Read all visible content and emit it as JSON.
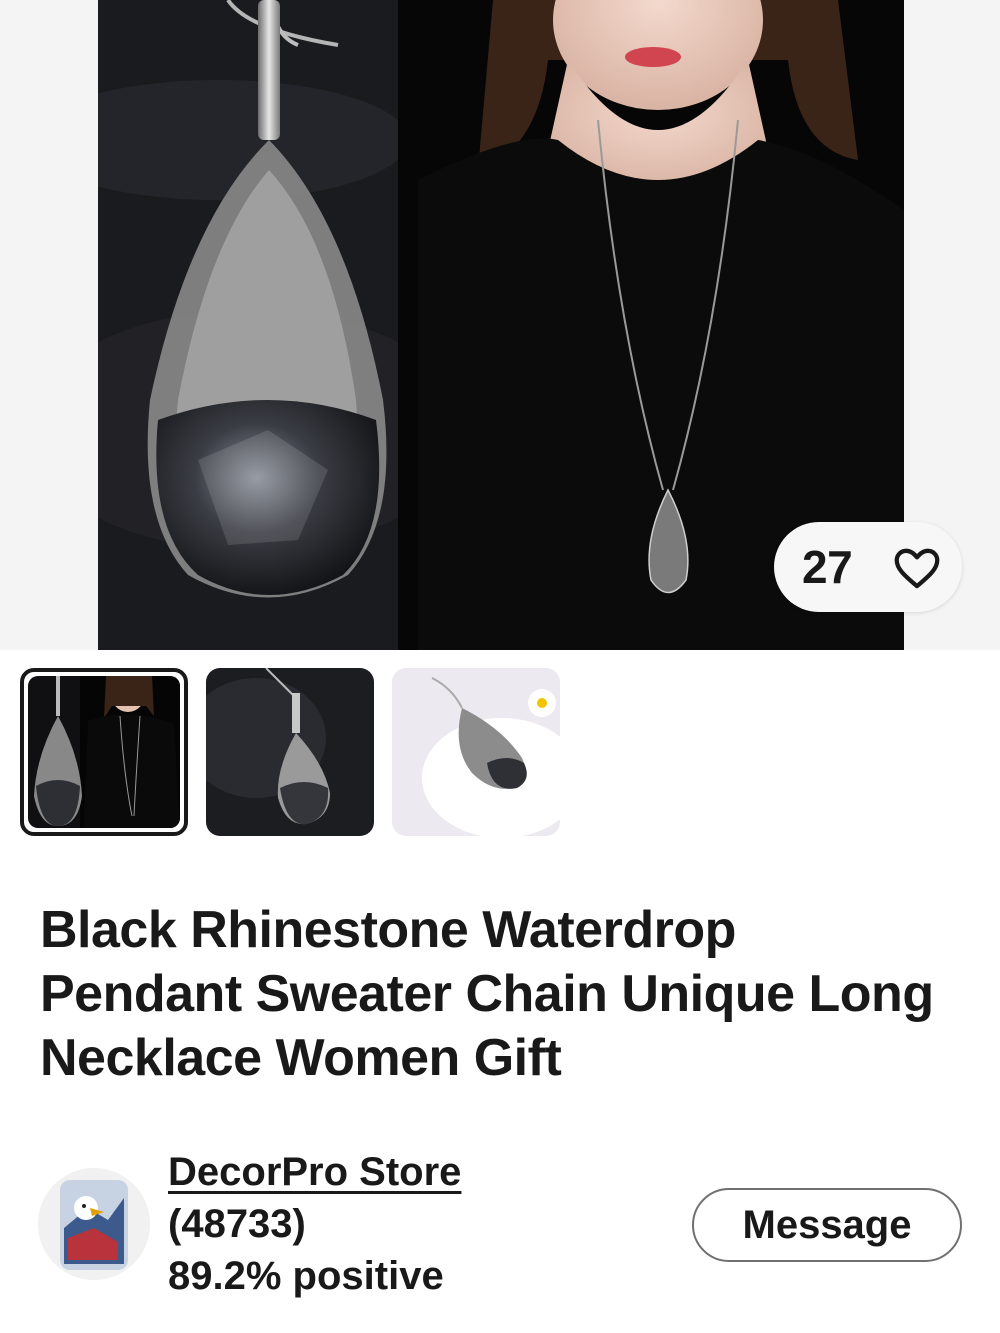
{
  "gallery": {
    "like_count": "27",
    "thumbnails": [
      {
        "active": true
      },
      {
        "active": false
      },
      {
        "active": false
      }
    ]
  },
  "listing": {
    "title": "Black Rhinestone Waterdrop Pendant Sweater Chain Unique Long Necklace Women Gift"
  },
  "seller": {
    "name": "DecorPro Store",
    "feedback_count": "(48733)",
    "positive": "89.2% positive",
    "message_label": "Message"
  },
  "colors": {
    "text": "#191919",
    "background": "#ffffff",
    "button_border": "#707070"
  },
  "icons": {
    "favorite": "heart-icon"
  }
}
